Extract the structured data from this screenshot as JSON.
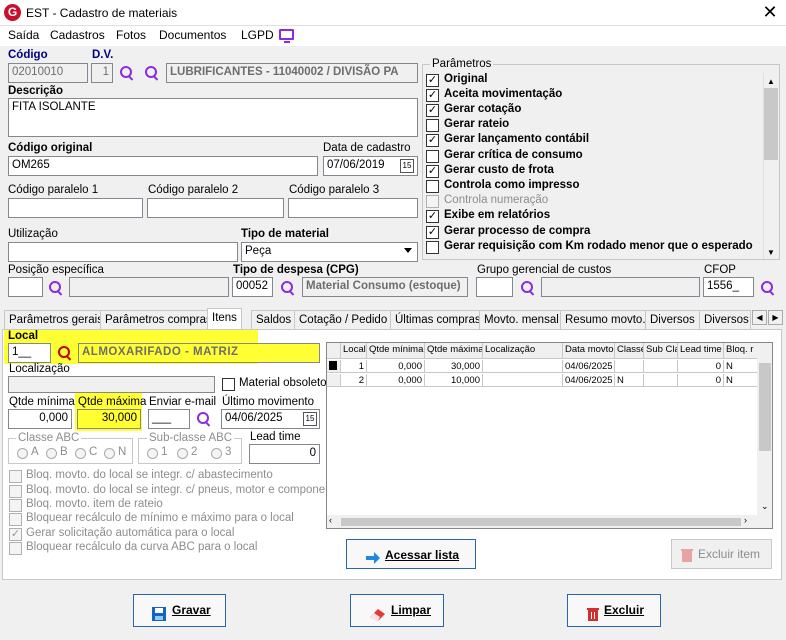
{
  "window": {
    "title": "EST - Cadastro de materiais",
    "app_icon_letter": "G"
  },
  "menu": [
    "Saída",
    "Cadastros",
    "Fotos",
    "Documentos",
    "LGPD"
  ],
  "header": {
    "codigo_label": "Código",
    "codigo_value": "02010010",
    "dv_label": "D.V.",
    "dv_value": "1",
    "grupo_value": "LUBRIFICANTES - 11040002 / DIVISÃO PA",
    "descricao_label": "Descrição",
    "descricao_value": "FITA ISOLANTE",
    "codigo_original_label": "Código original",
    "codigo_original_value": "OM265",
    "data_cadastro_label": "Data de cadastro",
    "data_cadastro_value": "07/06/2019",
    "cal_label": "15",
    "paralelo1_label": "Código paralelo 1",
    "paralelo2_label": "Código paralelo 2",
    "paralelo3_label": "Código paralelo 3",
    "utilizacao_label": "Utilização",
    "tipo_material_label": "Tipo de material",
    "tipo_material_value": "Peça",
    "posicao_label": "Posição específica",
    "tipo_despesa_label": "Tipo de despesa (CPG)",
    "tipo_despesa_code": "00052",
    "tipo_despesa_value": "Material Consumo (estoque)",
    "grupo_gerencial_label": "Grupo gerencial de custos",
    "cfop_label": "CFOP",
    "cfop_value": "1556_"
  },
  "parametros": {
    "title": "Parâmetros",
    "items": [
      {
        "label": "Original",
        "checked": true,
        "disabled": false
      },
      {
        "label": "Aceita movimentação",
        "checked": true,
        "disabled": false
      },
      {
        "label": "Gerar cotação",
        "checked": true,
        "disabled": false
      },
      {
        "label": "Gerar rateio",
        "checked": false,
        "disabled": false
      },
      {
        "label": "Gerar lançamento contábil",
        "checked": true,
        "disabled": false
      },
      {
        "label": "Gerar crítica de consumo",
        "checked": false,
        "disabled": false
      },
      {
        "label": "Gerar custo de frota",
        "checked": true,
        "disabled": false
      },
      {
        "label": "Controla como impresso",
        "checked": false,
        "disabled": false
      },
      {
        "label": "Controla numeração",
        "checked": false,
        "disabled": true
      },
      {
        "label": "Exibe em relatórios",
        "checked": true,
        "disabled": false
      },
      {
        "label": "Gerar processo de compra",
        "checked": true,
        "disabled": false
      },
      {
        "label": "Gerar requisição com Km rodado menor que o esperado",
        "checked": false,
        "disabled": false
      }
    ]
  },
  "tabs": [
    "Parâmetros gerais",
    "Parâmetros compras",
    "Itens",
    "Saldos",
    "Cotação / Pedido",
    "Últimas compras",
    "Movto. mensal",
    "Resumo movto.",
    "Diversos",
    "Diversos 2"
  ],
  "active_tab": "Itens",
  "itens": {
    "local_label": "Local",
    "local_code": "1__",
    "local_value": "ALMOXARIFADO - MATRIZ",
    "localizacao_label": "Localização",
    "material_obsoleto_label": "Material obsoleto",
    "qtde_minima_label": "Qtde mínima",
    "qtde_minima_value": "0,000",
    "qtde_maxima_label": "Qtde máxima",
    "qtde_maxima_value": "30,000",
    "enviar_email_label": "Enviar e-mail",
    "enviar_email_value": "___",
    "ultimo_movimento_label": "Último movimento",
    "ultimo_movimento_value": "04/06/2025",
    "classe_abc_label": "Classe ABC",
    "classe_abc_options": [
      "A",
      "B",
      "C",
      "N"
    ],
    "subclasse_abc_label": "Sub-classe ABC",
    "subclasse_abc_options": [
      "1",
      "2",
      "3"
    ],
    "lead_time_label": "Lead time",
    "lead_time_value": "0",
    "options": [
      {
        "label": "Bloq. movto. do local se integr. c/ abastecimento",
        "checked": false
      },
      {
        "label": "Bloq. movto. do local se integr. c/ pneus, motor e componente",
        "checked": false
      },
      {
        "label": "Bloq. movto. item de rateio",
        "checked": false
      },
      {
        "label": "Bloquear recálculo de mínimo e máximo para o local",
        "checked": false
      },
      {
        "label": "Gerar solicitação automática para o local",
        "checked": true
      },
      {
        "label": "Bloquear recálculo da curva ABC para o local",
        "checked": false
      }
    ]
  },
  "grid": {
    "columns": [
      "Local",
      "Qtde mínima",
      "Qtde máxima",
      "Localização",
      "Data movto",
      "Classe",
      "Sub Cla",
      "Lead time",
      "Bloq. r"
    ],
    "rows": [
      [
        "1",
        "0,000",
        "30,000",
        "",
        "04/06/2025",
        "",
        "",
        "0",
        "N"
      ],
      [
        "2",
        "0,000",
        "10,000",
        "",
        "04/06/2025",
        "N",
        "",
        "0",
        "N"
      ]
    ]
  },
  "buttons": {
    "acessar_lista": "Acessar lista",
    "excluir_item": "Excluir item",
    "gravar": "Gravar",
    "limpar": "Limpar",
    "excluir": "Excluir"
  },
  "colors": {
    "highlight": "#ffff33",
    "accent": "#8a2be2",
    "danger": "#c00000",
    "arrow": "#1e88e5"
  }
}
